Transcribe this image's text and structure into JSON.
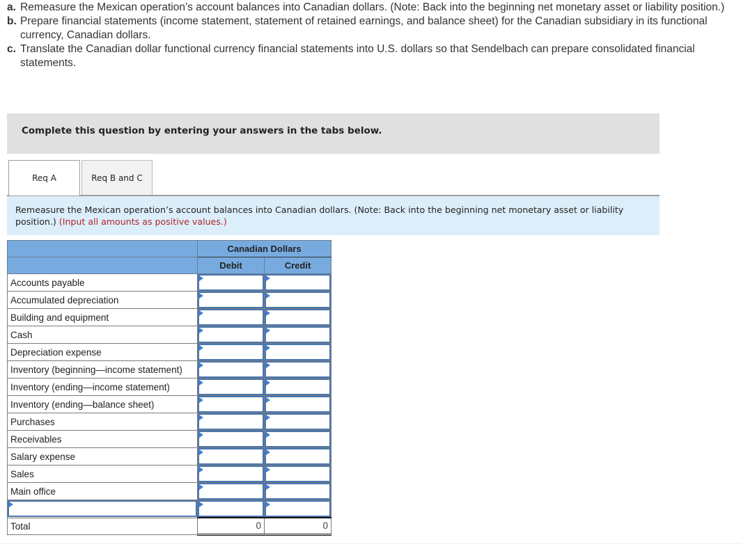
{
  "instructions": [
    {
      "letter": "a.",
      "text": "Remeasure the Mexican operation’s account balances into Canadian dollars. (Note: Back into the beginning net monetary asset or liability position.)"
    },
    {
      "letter": "b.",
      "text": "Prepare financial statements (income statement, statement of retained earnings, and balance sheet) for the Canadian subsidiary in its functional currency, Canadian dollars."
    },
    {
      "letter": "c.",
      "text": "Translate the Canadian dollar functional currency financial statements into U.S. dollars so that Sendelbach can prepare consolidated financial statements."
    }
  ],
  "banner": {
    "text": "Complete this question by entering your answers in the tabs below."
  },
  "tabs": [
    {
      "label": "Req A",
      "active": true
    },
    {
      "label": "Req B and C",
      "active": false
    }
  ],
  "prompt": {
    "text": "Remeasure the Mexican operation’s account balances into Canadian dollars. (Note: Back into the beginning net monetary asset or liability position.)",
    "hint": "(Input all amounts as positive values.)"
  },
  "table": {
    "group_header": "Canadian Dollars",
    "columns": [
      "Debit",
      "Credit"
    ],
    "rows": [
      {
        "label": "Accounts payable",
        "debit": "",
        "credit": ""
      },
      {
        "label": "Accumulated depreciation",
        "debit": "",
        "credit": ""
      },
      {
        "label": "Building and equipment",
        "debit": "",
        "credit": ""
      },
      {
        "label": "Cash",
        "debit": "",
        "credit": ""
      },
      {
        "label": "Depreciation expense",
        "debit": "",
        "credit": ""
      },
      {
        "label": "Inventory (beginning—income statement)",
        "debit": "",
        "credit": ""
      },
      {
        "label": "Inventory (ending—income statement)",
        "debit": "",
        "credit": ""
      },
      {
        "label": "Inventory (ending—balance sheet)",
        "debit": "",
        "credit": ""
      },
      {
        "label": "Purchases",
        "debit": "",
        "credit": ""
      },
      {
        "label": "Receivables",
        "debit": "",
        "credit": ""
      },
      {
        "label": "Salary expense",
        "debit": "",
        "credit": ""
      },
      {
        "label": "Sales",
        "debit": "",
        "credit": ""
      },
      {
        "label": "Main office",
        "debit": "",
        "credit": ""
      }
    ],
    "blank_row": {
      "label": "",
      "debit": "",
      "credit": ""
    },
    "total": {
      "label": "Total",
      "debit": "0",
      "credit": "0"
    }
  },
  "colors": {
    "header_blue": "#77abe0",
    "prompt_bg": "#dbeefa",
    "banner_bg": "#e0e0e0",
    "hint_red": "#b0262b",
    "input_border": "#4a76b0"
  }
}
